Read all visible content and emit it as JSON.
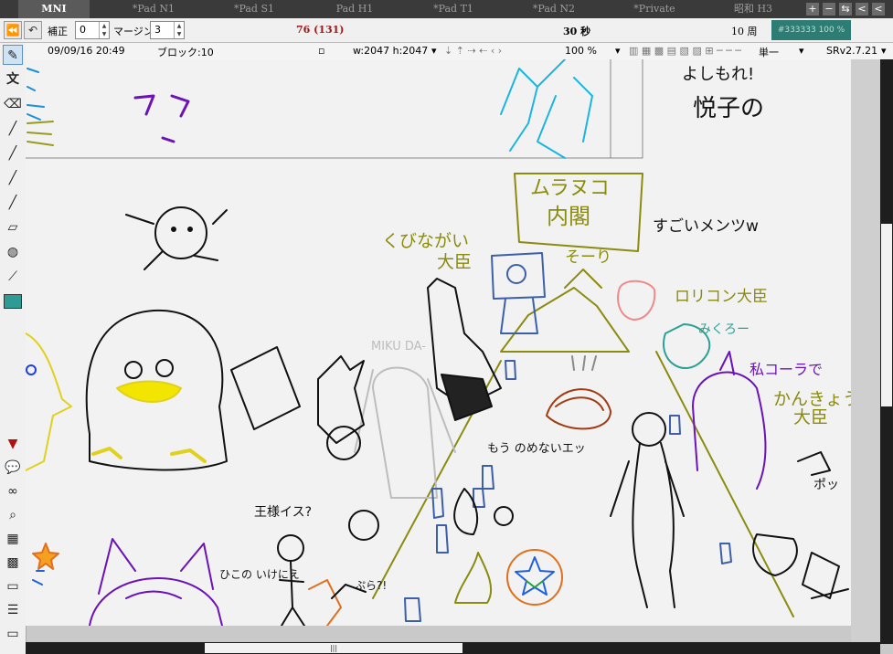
{
  "tabs": [
    {
      "label": "MNI",
      "active": true
    },
    {
      "label": "*Pad N1"
    },
    {
      "label": "*Pad S1"
    },
    {
      "label": "Pad H1"
    },
    {
      "label": "*Pad T1"
    },
    {
      "label": "*Pad N2"
    },
    {
      "label": "*Private"
    },
    {
      "label": "昭和 H3"
    }
  ],
  "window_controls": [
    "+",
    "−",
    "⇆",
    "<",
    "<"
  ],
  "toolbar": {
    "correction_label": "補正",
    "correction_value": "0",
    "margin_label": "マージン",
    "margin_value": "3",
    "line_count": "76 (131)",
    "seconds": "30 秒",
    "laps": "10 周",
    "color_status": "#333333 100 %"
  },
  "info": {
    "datetime": "09/09/16 20:49",
    "block": "ブロック:10",
    "size": "w:2047 h:2047",
    "zoom": "100 %",
    "mode": "単一",
    "version": "SRv2.7.21"
  },
  "tools": [
    "pen-icon",
    "text-icon",
    "eraser-icon",
    "brush-icon",
    "brush2-icon",
    "brush3-icon",
    "brush4-icon",
    "fill-icon",
    "stamp-icon",
    "dropper-icon",
    "color-swatch-icon",
    "save-icon",
    "chat-icon",
    "link-icon",
    "zoom-icon",
    "grid-icon",
    "hatch-icon",
    "page-icon",
    "lines-icon",
    "window-icon"
  ],
  "canvas_texts": {
    "t1": "よしもれ!",
    "t2": "悦子の",
    "t3": "ムラヌコ",
    "t4": "内閣",
    "t5": "すごいメンツw",
    "t6": "くびながい",
    "t7": "大臣",
    "t8": "そーり",
    "t9": "ロリコン大臣",
    "t10": "みくろー",
    "t11": "私コーラで",
    "t12": "かんきょう",
    "t13": "大臣",
    "t14": "MIKU DA-",
    "t15": "もう のめないエッ",
    "t16": "王様イス?",
    "t17": "ひこの いけにえ",
    "t18": "ポッ",
    "t19": "ぷら?!"
  },
  "colors": {
    "accent": "#2e7d74",
    "canvas_bg": "#f2f2f2"
  }
}
